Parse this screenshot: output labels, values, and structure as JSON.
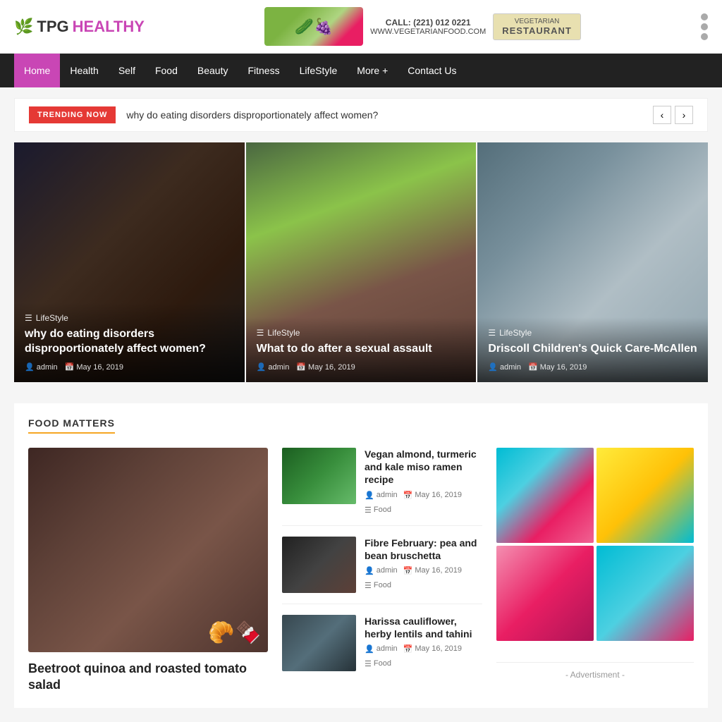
{
  "logo": {
    "prefix": "TPG",
    "suffix": "HEALTHY",
    "icon": "🌿"
  },
  "header": {
    "call": "CALL: (221) 012 0221",
    "website": "WWW.VEGETARIANFOOD.COM",
    "restaurant_label": "VEGETARIAN",
    "restaurant_name": "RESTAURANT"
  },
  "nav": {
    "items": [
      {
        "label": "Home",
        "active": true
      },
      {
        "label": "Health",
        "active": false
      },
      {
        "label": "Self",
        "active": false
      },
      {
        "label": "Food",
        "active": false
      },
      {
        "label": "Beauty",
        "active": false
      },
      {
        "label": "Fitness",
        "active": false
      },
      {
        "label": "LifeStyle",
        "active": false
      },
      {
        "label": "More +",
        "active": false
      },
      {
        "label": "Contact Us",
        "active": false
      }
    ]
  },
  "trending": {
    "label": "TRENDING NOW",
    "text": "why do eating disorders disproportionately affect women?"
  },
  "featured_articles": [
    {
      "category": "LifeStyle",
      "title": "why do eating disorders disproportionately affect women?",
      "author": "admin",
      "date": "May 16, 2019"
    },
    {
      "category": "LifeStyle",
      "title": "What to do after a sexual assault",
      "author": "admin",
      "date": "May 16, 2019"
    },
    {
      "category": "LifeStyle",
      "title": "Driscoll Children's Quick Care-McAllen",
      "author": "admin",
      "date": "May 16, 2019"
    }
  ],
  "food_matters": {
    "section_title": "FOOD MATTERS",
    "main_article": {
      "title": "Beetroot quinoa and roasted tomato salad"
    },
    "articles": [
      {
        "title": "Vegan almond, turmeric and kale miso ramen recipe",
        "author": "admin",
        "date": "May 16, 2019",
        "category": "Food"
      },
      {
        "title": "Fibre February: pea and bean bruschetta",
        "author": "admin",
        "date": "May 16, 2019",
        "category": "Food"
      },
      {
        "title": "Harissa cauliflower, herby lentils and tahini",
        "author": "admin",
        "date": "May 16, 2019",
        "category": "Food"
      }
    ]
  },
  "advertisment_label": "- Advertisment -"
}
